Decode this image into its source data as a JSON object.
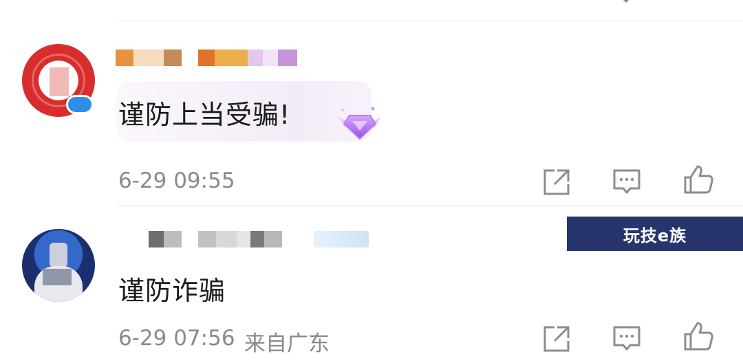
{
  "comments": [
    {
      "text": "谨防上当受骗!",
      "time": "6-29 09:55",
      "location": ""
    },
    {
      "text": "谨防诈骗",
      "time": "6-29 07:56",
      "location": "来自广东"
    }
  ],
  "ad": {
    "label": "玩技e族"
  },
  "icons": {
    "share": "share-icon",
    "reply": "comment-icon",
    "like": "thumbs-up-icon",
    "gem": "gem-badge-icon"
  },
  "colors": {
    "text_primary": "#1a1a1a",
    "text_meta": "#8a8a8a",
    "ad_background": "#26356e",
    "icon_gray": "#8c8c8c"
  }
}
